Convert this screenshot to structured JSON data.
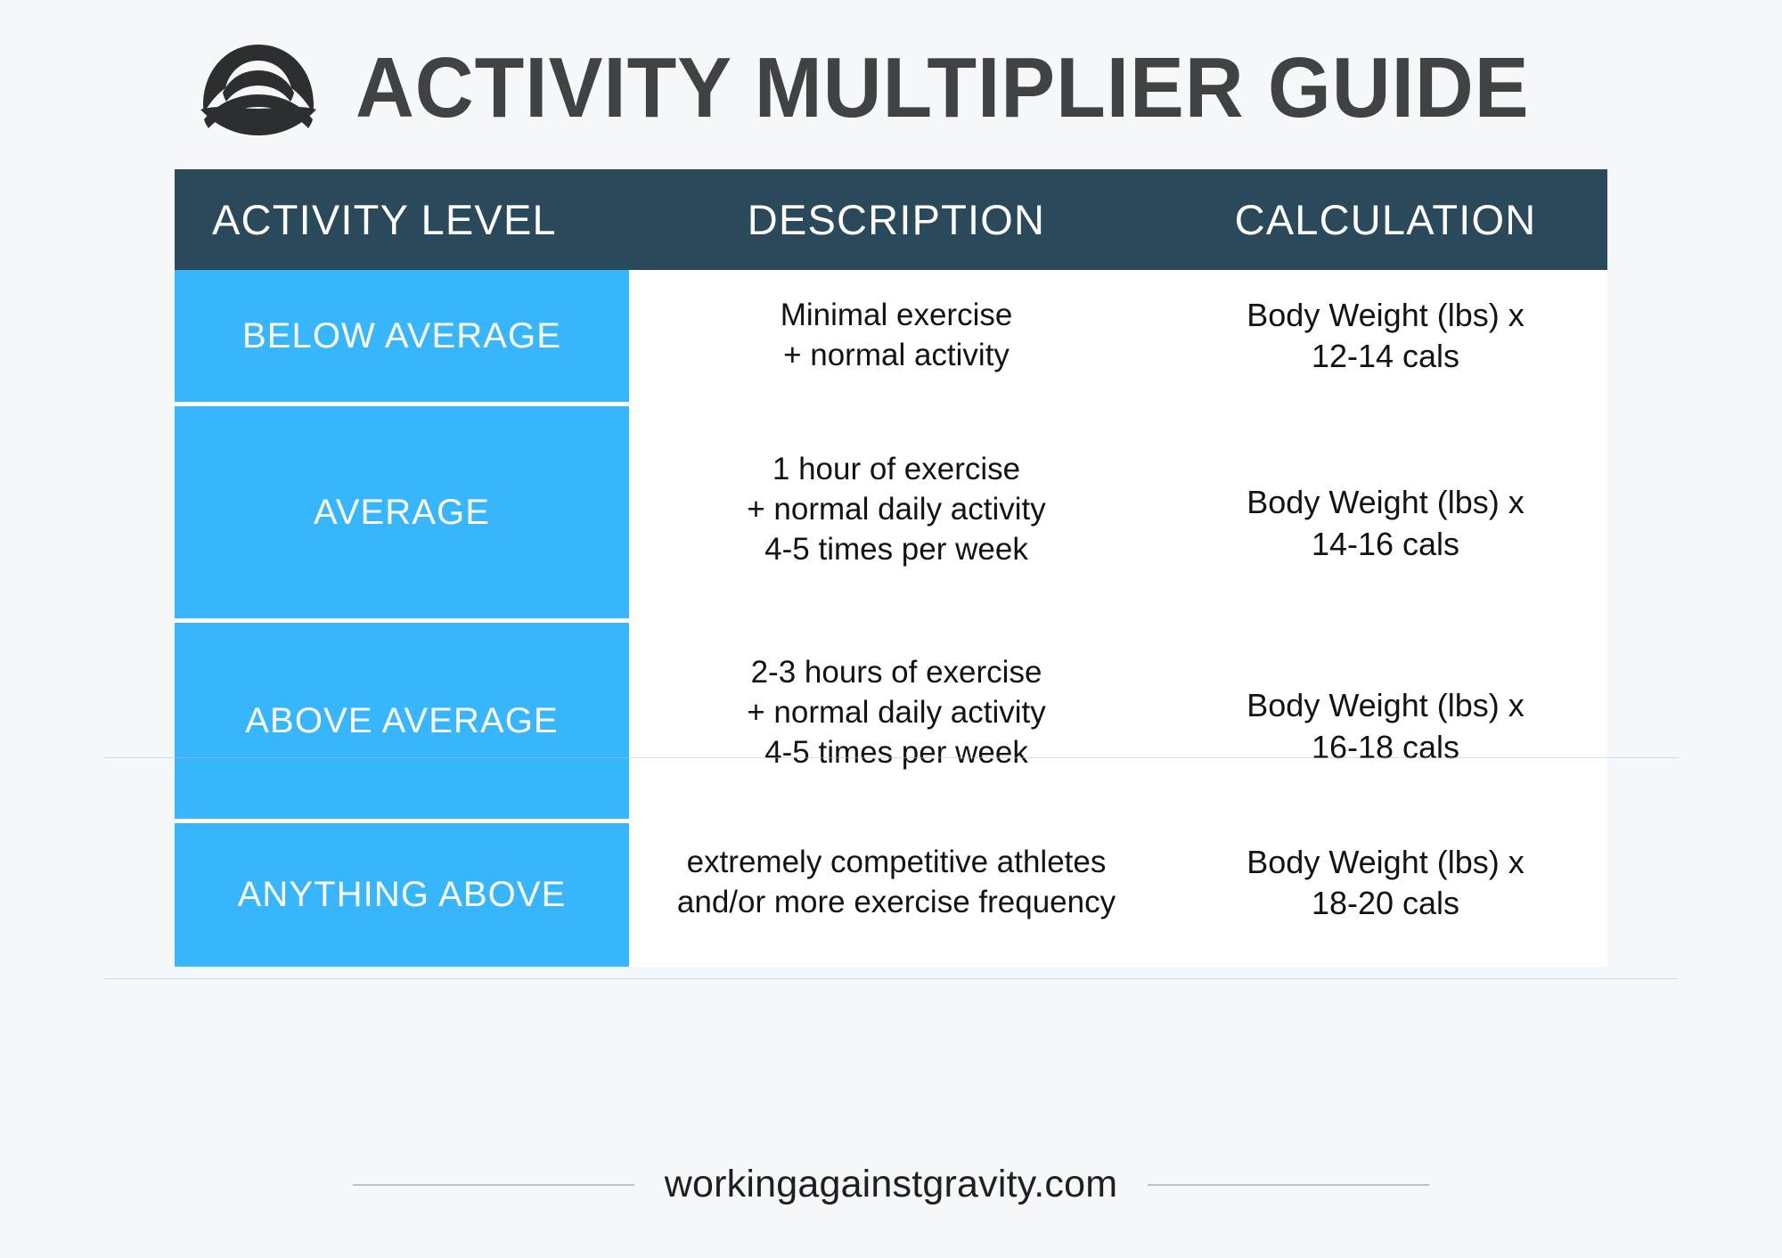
{
  "header": {
    "title": "ACTIVITY MULTIPLIER GUIDE",
    "logo_icon": "dome-arcs-logo-icon"
  },
  "table": {
    "columns": [
      {
        "key": "level",
        "label": "ACTIVITY LEVEL"
      },
      {
        "key": "description",
        "label": "DESCRIPTION"
      },
      {
        "key": "calculation",
        "label": "CALCULATION"
      }
    ],
    "rows": [
      {
        "level": "BELOW AVERAGE",
        "description": [
          "Minimal exercise",
          "+ normal activity"
        ],
        "calculation": [
          "Body Weight (lbs) x",
          "12-14 cals"
        ]
      },
      {
        "level": "AVERAGE",
        "description": [
          "1 hour of exercise",
          "+ normal daily activity",
          "4-5 times per week"
        ],
        "calculation": [
          "Body Weight (lbs) x",
          "14-16 cals"
        ]
      },
      {
        "level": "ABOVE AVERAGE",
        "description": [
          "2-3 hours of exercise",
          "+ normal daily activity",
          "4-5 times per week"
        ],
        "calculation": [
          "Body Weight (lbs) x",
          "16-18 cals"
        ]
      },
      {
        "level": "ANYTHING ABOVE",
        "description": [
          "extremely competitive athletes",
          "and/or more exercise frequency"
        ],
        "calculation": [
          "Body Weight (lbs) x",
          "18-20 cals"
        ]
      }
    ]
  },
  "footer": {
    "website": "workingagainstgravity.com"
  },
  "colors": {
    "page_background": "#f4f8fb",
    "header_bar": "#2a4a5b",
    "accent_blue": "#38b6fd",
    "title_text": "#3f4345",
    "body_text": "#111314",
    "logo": "#2b2f31",
    "rule": "#bcc3c7"
  }
}
